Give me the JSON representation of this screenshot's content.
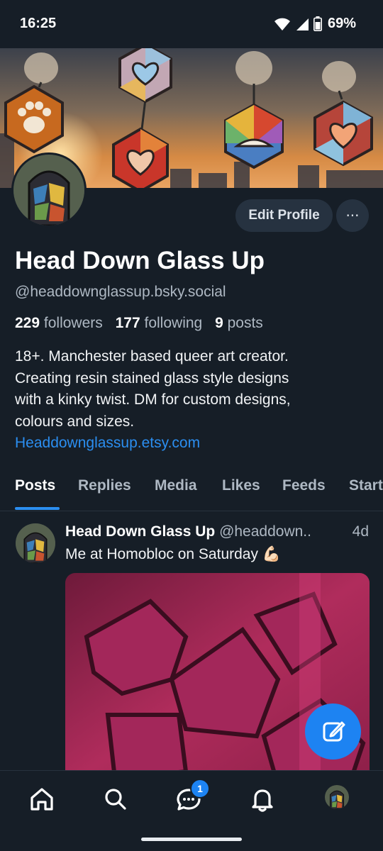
{
  "status_bar": {
    "time": "16:25",
    "battery": "69%"
  },
  "profile": {
    "display_name": "Head Down Glass Up",
    "handle": "@headdownglassup.bsky.social",
    "edit_profile_label": "Edit Profile",
    "more_label": "···",
    "followers_count": "229",
    "followers_label": "followers",
    "following_count": "177",
    "following_label": "following",
    "posts_count": "9",
    "posts_label": "posts",
    "bio_lines": [
      "18+. Manchester based queer art creator.",
      "Creating resin stained glass style designs",
      "with a kinky twist. DM for custom designs,",
      "colours and sizes."
    ],
    "bio_link": "Headdownglassup.etsy.com"
  },
  "tabs": [
    "Posts",
    "Replies",
    "Media",
    "Likes",
    "Feeds",
    "Start"
  ],
  "active_tab": "Posts",
  "post": {
    "author": "Head Down Glass Up",
    "handle": "@headdown..",
    "time": "4d",
    "text": "Me at Homobloc on Saturday 💪🏻"
  },
  "nav": {
    "items": [
      "home-icon",
      "search-icon",
      "chat-icon",
      "bell-icon",
      "profile-avatar"
    ],
    "chat_badge": "1"
  },
  "colors": {
    "background": "#161e27",
    "accent": "#1d83f2",
    "link": "#2b8ef0",
    "muted_text": "#aeb8c3",
    "button_bg": "#263240"
  }
}
